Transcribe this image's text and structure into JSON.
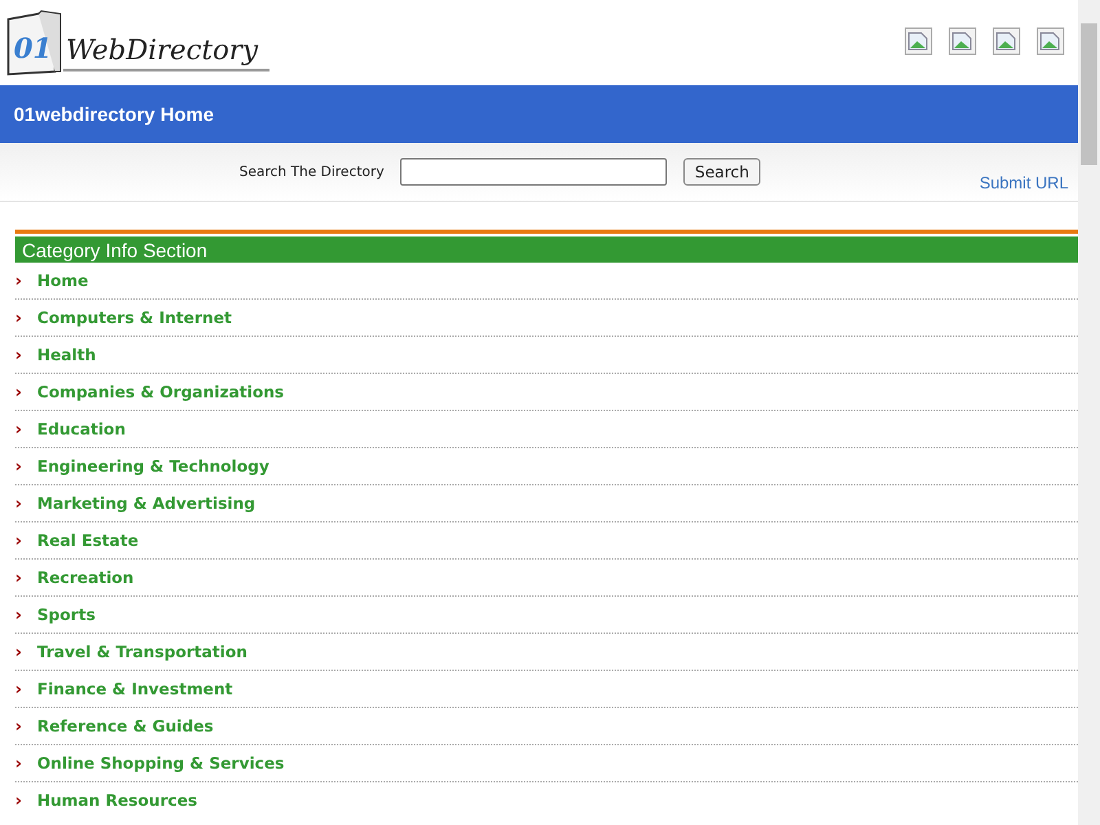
{
  "logo": {
    "number": "01",
    "name": "WebDirectory"
  },
  "nav": {
    "title": "01webdirectory Home"
  },
  "search": {
    "label": "Search The Directory",
    "button": "Search",
    "submit_link": "Submit URL"
  },
  "section": {
    "title": "Category Info Section"
  },
  "categories": [
    {
      "label": "Home",
      "marker": "›"
    },
    {
      "label": "Computers & Internet",
      "marker": "›"
    },
    {
      "label": "Health",
      "marker": "›"
    },
    {
      "label": "Companies & Organizations",
      "marker": "›"
    },
    {
      "label": "Education",
      "marker": "›"
    },
    {
      "label": "Engineering & Technology",
      "marker": "›"
    },
    {
      "label": "Marketing & Advertising",
      "marker": "›"
    },
    {
      "label": "Real Estate",
      "marker": "›"
    },
    {
      "label": "Recreation",
      "marker": "›"
    },
    {
      "label": "Sports",
      "marker": "›"
    },
    {
      "label": "Travel & Transportation",
      "marker": "›"
    },
    {
      "label": "Finance & Investment",
      "marker": "›"
    },
    {
      "label": "Reference & Guides",
      "marker": "›"
    },
    {
      "label": "Online Shopping & Services",
      "marker": "›"
    },
    {
      "label": "Human Resources",
      "marker": "›"
    }
  ]
}
